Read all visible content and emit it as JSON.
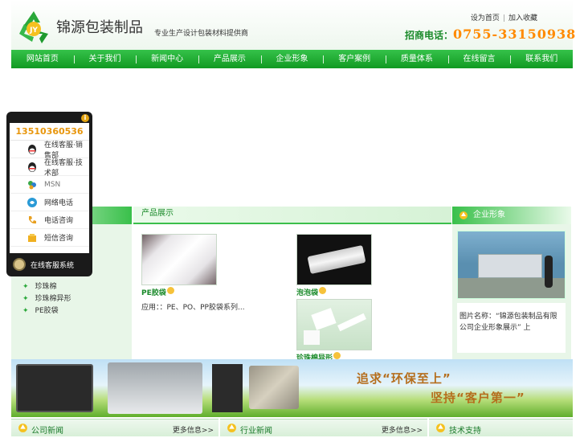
{
  "header": {
    "brand": "锦源包装制品",
    "logo_initials": "JY",
    "slogan": "专业生产设计包装材料提供商",
    "top_links": [
      "设为首页",
      "加入收藏"
    ],
    "hotline_label": "招商电话：",
    "hotline_number": "0755-33150938"
  },
  "nav": {
    "items": [
      "网站首页",
      "关于我们",
      "新闻中心",
      "产品展示",
      "企业形象",
      "客户案例",
      "质量体系",
      "在线留言",
      "联系我们"
    ]
  },
  "contact_widget": {
    "phone": "13510360536",
    "rows": [
      {
        "icon": "qq-icon",
        "label": "在线客服·销售部"
      },
      {
        "icon": "qq-icon",
        "label": "在线客服·技术部"
      },
      {
        "icon": "msn-icon",
        "label": "MSN"
      },
      {
        "icon": "skype-icon",
        "label": "网络电话"
      },
      {
        "icon": "telephone-icon",
        "label": "电话咨询"
      },
      {
        "icon": "sms-icon",
        "label": "短信咨询"
      }
    ],
    "footer_label": "在线客服系统"
  },
  "left_menu": {
    "items": [
      "珍珠棉",
      "珍珠棉异形",
      "PE胶袋"
    ]
  },
  "products": {
    "title": "产品展示",
    "items": [
      {
        "name": "PE胶袋",
        "desc": "应用：：PE、PO、PP胶袋系列..."
      },
      {
        "name": "泡泡袋"
      },
      {
        "name": "珍珠棉异形"
      }
    ]
  },
  "right_panel": {
    "title": "企业形象",
    "text": "图片名称：“锦源包装制品有限公司企业形象展示” 上"
  },
  "banner": {
    "line1": "追求“环保至上”",
    "line2": "坚持“客户第一”"
  },
  "bottom": {
    "sections": [
      {
        "title": "公司新闻",
        "more": "更多信息>>"
      },
      {
        "title": "行业新闻",
        "more": "更多信息>>"
      },
      {
        "title": "技术支持",
        "more": ""
      }
    ]
  },
  "colors": {
    "nav_green": "#119a22",
    "brand_green": "#1a8a2a",
    "hotline_orange": "#ff8a00",
    "phone_orange": "#e8960c"
  }
}
